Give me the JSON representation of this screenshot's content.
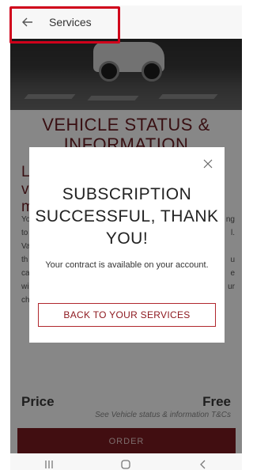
{
  "header": {
    "back_icon": "arrow-left-icon",
    "title": "Services"
  },
  "page": {
    "vehicle_title": "VEHICLE STATUS & INFORMATION",
    "sub_heading_fragment": "L\nv\nm",
    "body_left": [
      "Yo",
      "to",
      "Va",
      "th",
      "ca",
      "wi",
      "ch"
    ],
    "body_right": [
      "ng",
      "l.",
      "",
      "u",
      "e",
      "ur",
      ""
    ],
    "price_label": "Price",
    "price_value": "Free",
    "price_note": "See Vehicle status & information T&Cs",
    "order_label": "ORDER"
  },
  "modal": {
    "title": "SUBSCRIPTION SUCCESSFUL, THANK YOU!",
    "message": "Your contract is available on your account.",
    "button_label": "BACK TO YOUR SERVICES",
    "close_icon": "close-icon"
  },
  "nav": {
    "recent_icon": "recent-apps-icon",
    "home_icon": "home-icon",
    "back_icon": "back-chevron-icon"
  },
  "colors": {
    "brand": "#7b1c21",
    "highlight": "#d0021b"
  }
}
